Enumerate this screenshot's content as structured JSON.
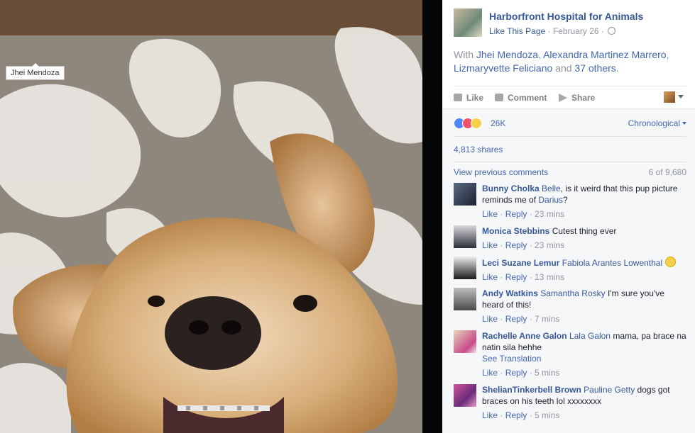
{
  "photo": {
    "tag_label": "Jhei Mendoza"
  },
  "post": {
    "page_name": "Harborfront Hospital for Animals",
    "like_page": "Like This Page",
    "date": "February 26",
    "with_prefix": "With",
    "with_people": [
      "Jhei Mendoza",
      "Alexandra Martinez Marrero",
      "Lizmaryvette Feliciano"
    ],
    "with_and": "and",
    "with_others": "37 others",
    "with_suffix": "."
  },
  "actions": {
    "like": "Like",
    "comment": "Comment",
    "share": "Share"
  },
  "stats": {
    "reactions": "26K",
    "sort": "Chronological",
    "shares": "4,813 shares",
    "view_previous": "View previous comments",
    "comment_count": "6 of 9,680"
  },
  "colors": {
    "link": "#365899",
    "meta": "#90949c",
    "panel_bg": "#f6f7f9"
  },
  "comments": [
    {
      "name": "Bunny Cholka",
      "tag": "Belle",
      "text": ", is it weird that this pup picture reminds me of ",
      "tag2": "Darius",
      "text2": "?",
      "like": "Like",
      "reply": "Reply",
      "time": "23 mins"
    },
    {
      "name": "Monica Stebbins",
      "tag": "",
      "text": "Cutest thing ever",
      "like": "Like",
      "reply": "Reply",
      "time": "23 mins"
    },
    {
      "name": "Leci Suzane Lemur",
      "tag": "Fabiola Arantes Lowenthal",
      "text": "",
      "emoji": "smile-emoji",
      "like": "Like",
      "reply": "Reply",
      "time": "13 mins"
    },
    {
      "name": "Andy Watkins",
      "tag": "Samantha Rosky",
      "text": "I'm sure you've heard of this!",
      "like": "Like",
      "reply": "Reply",
      "time": "7 mins"
    },
    {
      "name": "Rachelle Anne Galon",
      "tag": "Lala Galon",
      "text": "mama, pa brace na natin sila hehhe",
      "see_translation": "See Translation",
      "like": "Like",
      "reply": "Reply",
      "time": "5 mins"
    },
    {
      "name": "ShelianTinkerbell Brown",
      "tag": "Pauline Getty",
      "text": "dogs got braces on his teeth lol xxxxxxxx",
      "like": "Like",
      "reply": "Reply",
      "time": "5 mins"
    }
  ]
}
